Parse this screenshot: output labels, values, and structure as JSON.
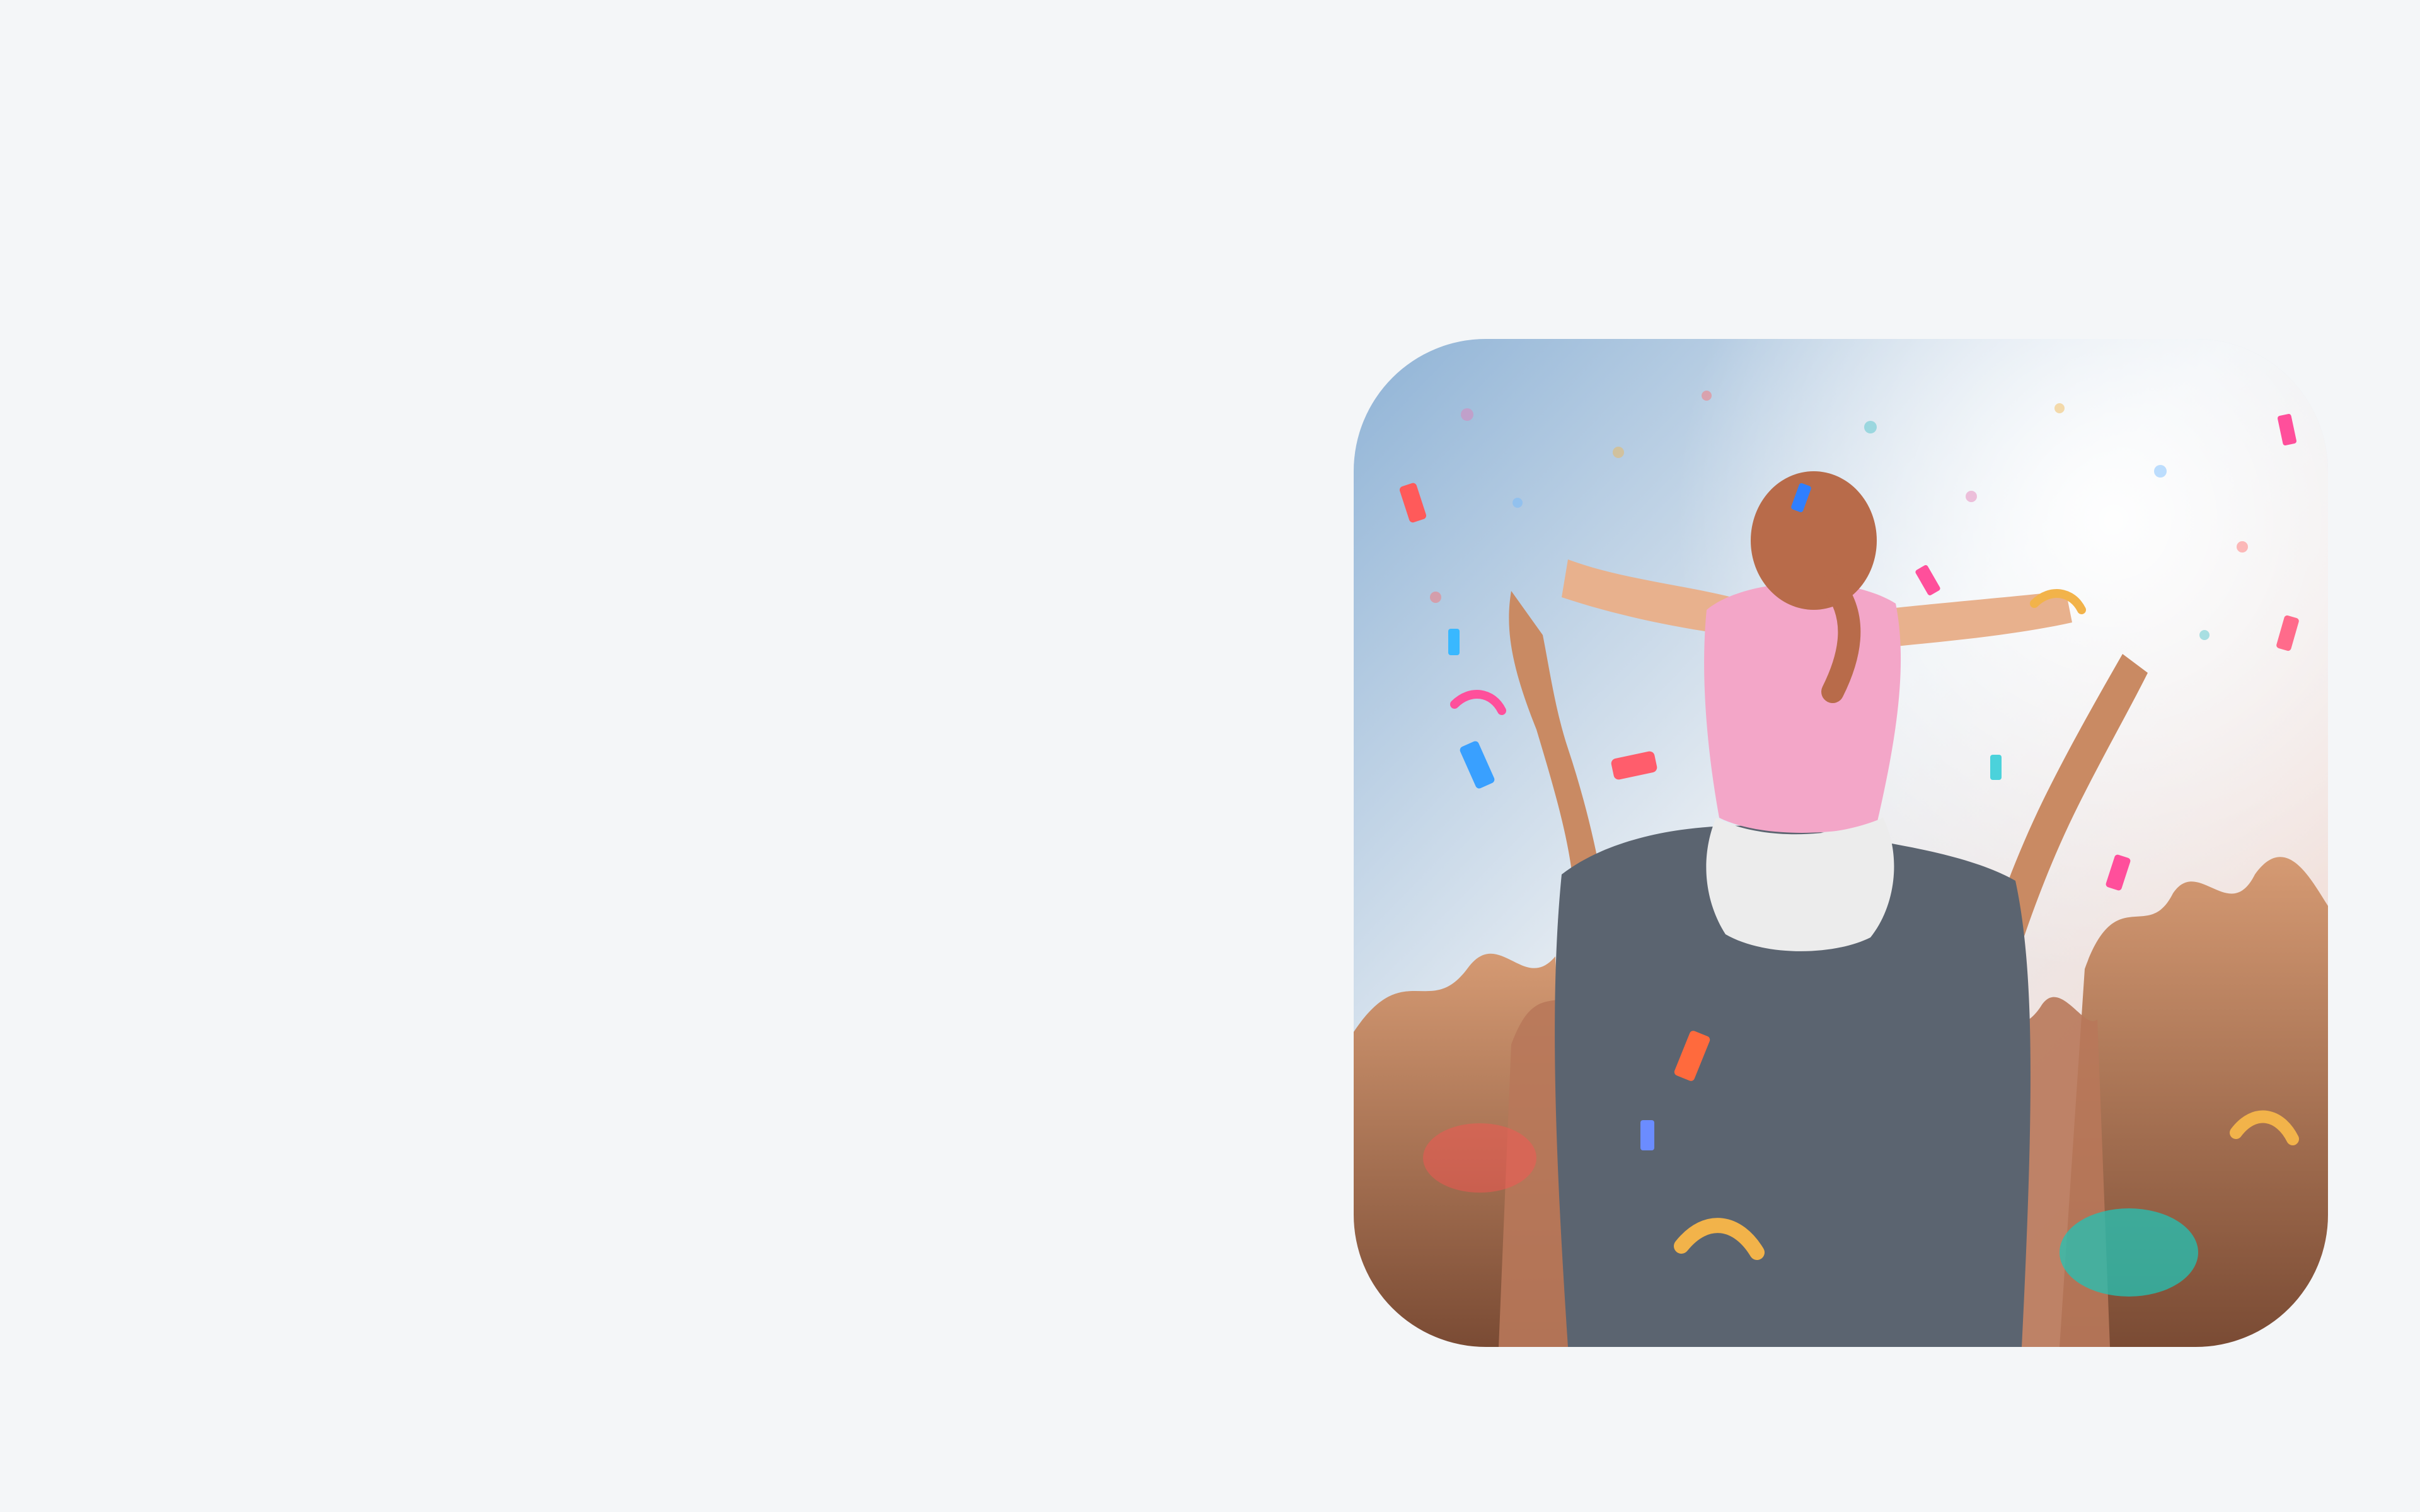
{
  "hero": {
    "image": "concert-crowd-confetti-photo",
    "subject": "child-on-shoulders-with-confetti-icon",
    "colors": {
      "page_background": "#f4f6f8",
      "sky_top": "#8fb3d6",
      "sky_mid": "#e9eef3",
      "glow": "#f7d6c9",
      "shirt_child": "#f3a6c8",
      "shirt_adult": "#5b6470",
      "skin": "#c98a63"
    }
  }
}
